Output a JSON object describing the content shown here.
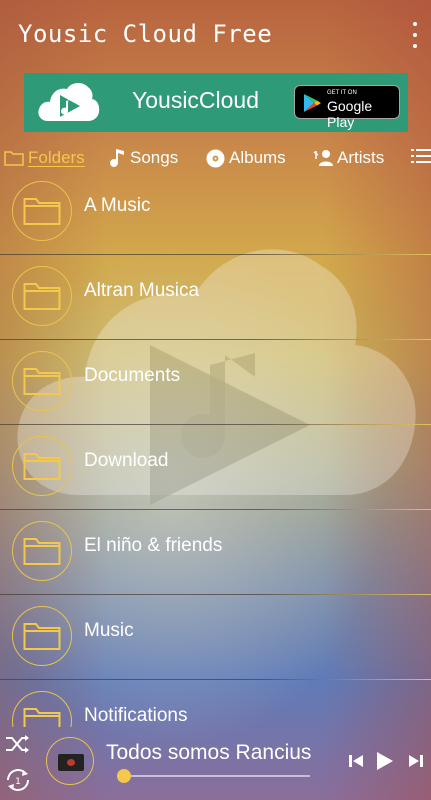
{
  "app": {
    "title": "Yousic Cloud Free"
  },
  "banner": {
    "app_name": "YousicCloud",
    "store_small": "GET IT ON",
    "store_big": "Google Play"
  },
  "tabs": [
    {
      "label": "Folders",
      "icon": "folder-icon",
      "active": true
    },
    {
      "label": "Songs",
      "icon": "music-note-icon",
      "active": false
    },
    {
      "label": "Albums",
      "icon": "disc-icon",
      "active": false
    },
    {
      "label": "Artists",
      "icon": "artist-icon",
      "active": false
    }
  ],
  "folders": [
    {
      "name": "A Music"
    },
    {
      "name": "Altran Musica"
    },
    {
      "name": "Documents"
    },
    {
      "name": "Download"
    },
    {
      "name": "El niño  & friends"
    },
    {
      "name": "Music"
    },
    {
      "name": "Notifications"
    }
  ],
  "player": {
    "track_title": "Todos somos Rancius",
    "progress": 0.0,
    "repeat_count": "1"
  },
  "colors": {
    "accent": "#f3c84b",
    "banner_bg": "#2e9a78",
    "divider_gold": "#e6c864"
  }
}
